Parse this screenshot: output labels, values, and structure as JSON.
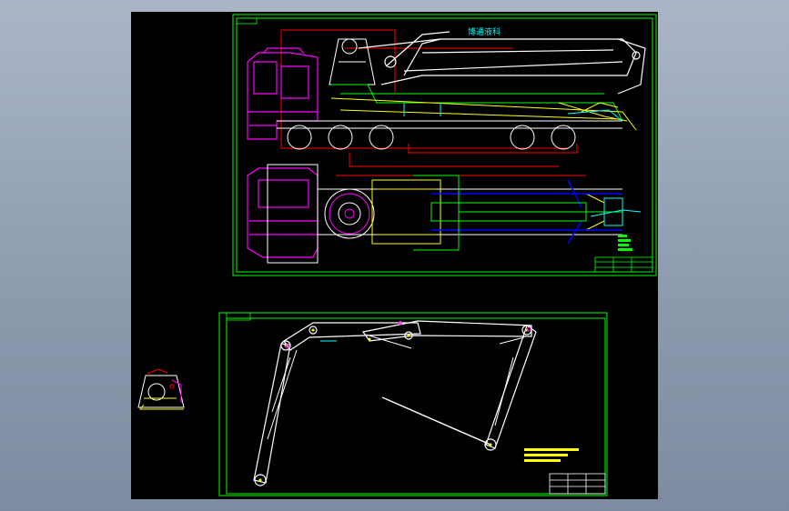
{
  "drawing": {
    "background": "#000000",
    "sheet_1_banner": "博通液科",
    "sheet_1_chassis_label": "",
    "colors": {
      "frame": "#00ff00",
      "cab": "#ff00ff",
      "boom": "#ffffff",
      "outrigger": "#ffff00",
      "red_line": "#ff0000",
      "cyan": "#00ffff",
      "blue": "#0000ff",
      "green": "#00ff00",
      "yellow": "#ffff00"
    }
  }
}
